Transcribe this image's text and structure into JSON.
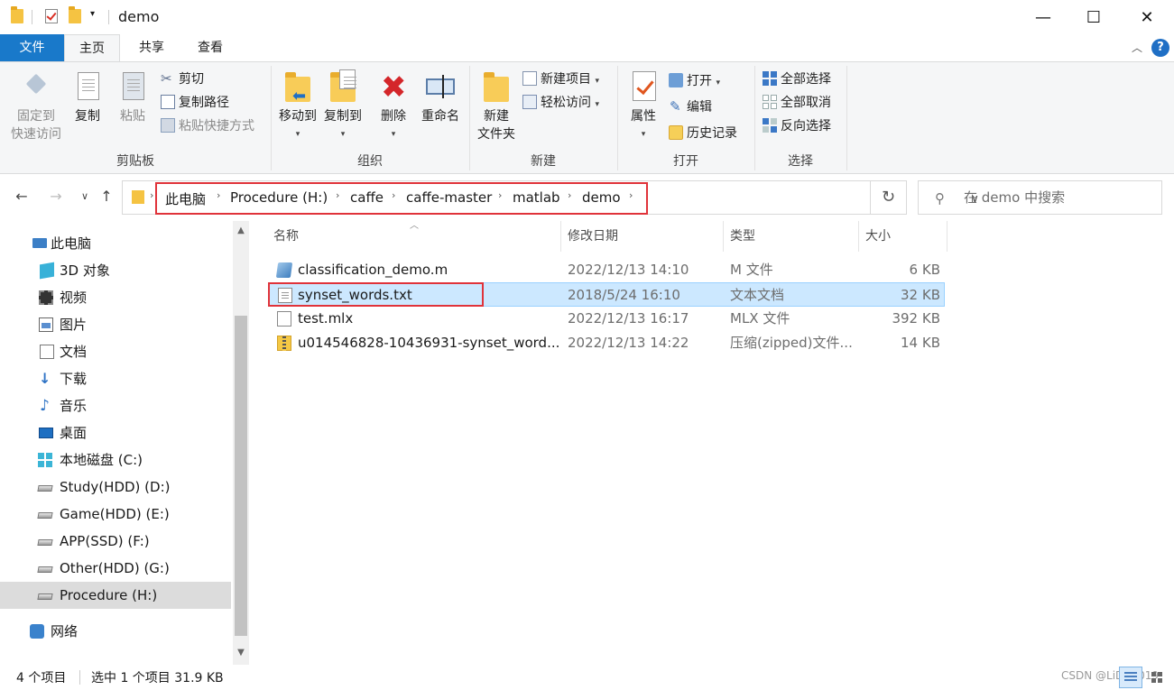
{
  "window": {
    "title": "demo",
    "minimize": "—",
    "maximize": "☐",
    "close": "✕"
  },
  "tabs": {
    "file": "文件",
    "home": "主页",
    "share": "共享",
    "view": "查看",
    "help": "?"
  },
  "ribbon": {
    "clipboard": {
      "label": "剪贴板",
      "pin": "固定到\n快速访问",
      "pin_line1": "固定到",
      "pin_line2": "快速访问",
      "copy": "复制",
      "paste": "粘贴",
      "cut": "剪切",
      "copy_path": "复制路径",
      "paste_shortcut": "粘贴快捷方式"
    },
    "organize": {
      "label": "组织",
      "move_to": "移动到",
      "copy_to": "复制到",
      "delete": "删除",
      "rename": "重命名"
    },
    "new": {
      "label": "新建",
      "new_folder_line1": "新建",
      "new_folder_line2": "文件夹",
      "new_item": "新建项目",
      "easy_access": "轻松访问"
    },
    "open": {
      "label": "打开",
      "properties": "属性",
      "open": "打开",
      "edit": "编辑",
      "history": "历史记录"
    },
    "select": {
      "label": "选择",
      "select_all": "全部选择",
      "select_none": "全部取消",
      "invert": "反向选择"
    }
  },
  "address": {
    "crumbs": [
      "此电脑",
      "Procedure (H:)",
      "caffe",
      "caffe-master",
      "matlab",
      "demo"
    ],
    "search_placeholder": "在 demo 中搜索"
  },
  "nav": {
    "items": [
      {
        "label": "此电脑",
        "icon": "computer-icon"
      },
      {
        "label": "3D 对象",
        "icon": "3d-objects-icon"
      },
      {
        "label": "视频",
        "icon": "video-icon"
      },
      {
        "label": "图片",
        "icon": "pictures-icon"
      },
      {
        "label": "文档",
        "icon": "documents-icon"
      },
      {
        "label": "下载",
        "icon": "download-icon"
      },
      {
        "label": "音乐",
        "icon": "music-icon"
      },
      {
        "label": "桌面",
        "icon": "desktop-icon"
      },
      {
        "label": "本地磁盘 (C:)",
        "icon": "windows-drive-icon"
      },
      {
        "label": "Study(HDD) (D:)",
        "icon": "drive-icon"
      },
      {
        "label": "Game(HDD) (E:)",
        "icon": "drive-icon"
      },
      {
        "label": "APP(SSD) (F:)",
        "icon": "drive-icon"
      },
      {
        "label": "Other(HDD) (G:)",
        "icon": "drive-icon"
      },
      {
        "label": "Procedure (H:)",
        "icon": "drive-icon",
        "selected": true
      },
      {
        "label": "网络",
        "icon": "network-icon"
      }
    ]
  },
  "files": {
    "columns": [
      "名称",
      "修改日期",
      "类型",
      "大小"
    ],
    "rows": [
      {
        "name": "classification_demo.m",
        "date": "2022/12/13 14:10",
        "type": "M 文件",
        "size": "6 KB",
        "icon": "matlab-file-icon"
      },
      {
        "name": "synset_words.txt",
        "date": "2018/5/24 16:10",
        "type": "文本文档",
        "size": "32 KB",
        "icon": "text-file-icon",
        "selected": true
      },
      {
        "name": "test.mlx",
        "date": "2022/12/13 16:17",
        "type": "MLX 文件",
        "size": "392 KB",
        "icon": "mlx-file-icon"
      },
      {
        "name": "u014546828-10436931-synset_word...",
        "date": "2022/12/13 14:22",
        "type": "压缩(zipped)文件...",
        "size": "14 KB",
        "icon": "zip-file-icon"
      }
    ]
  },
  "status": {
    "count": "4 个项目",
    "selection": "选中 1 个项目  31.9 KB",
    "watermark": "CSDN @LiDB2019"
  }
}
